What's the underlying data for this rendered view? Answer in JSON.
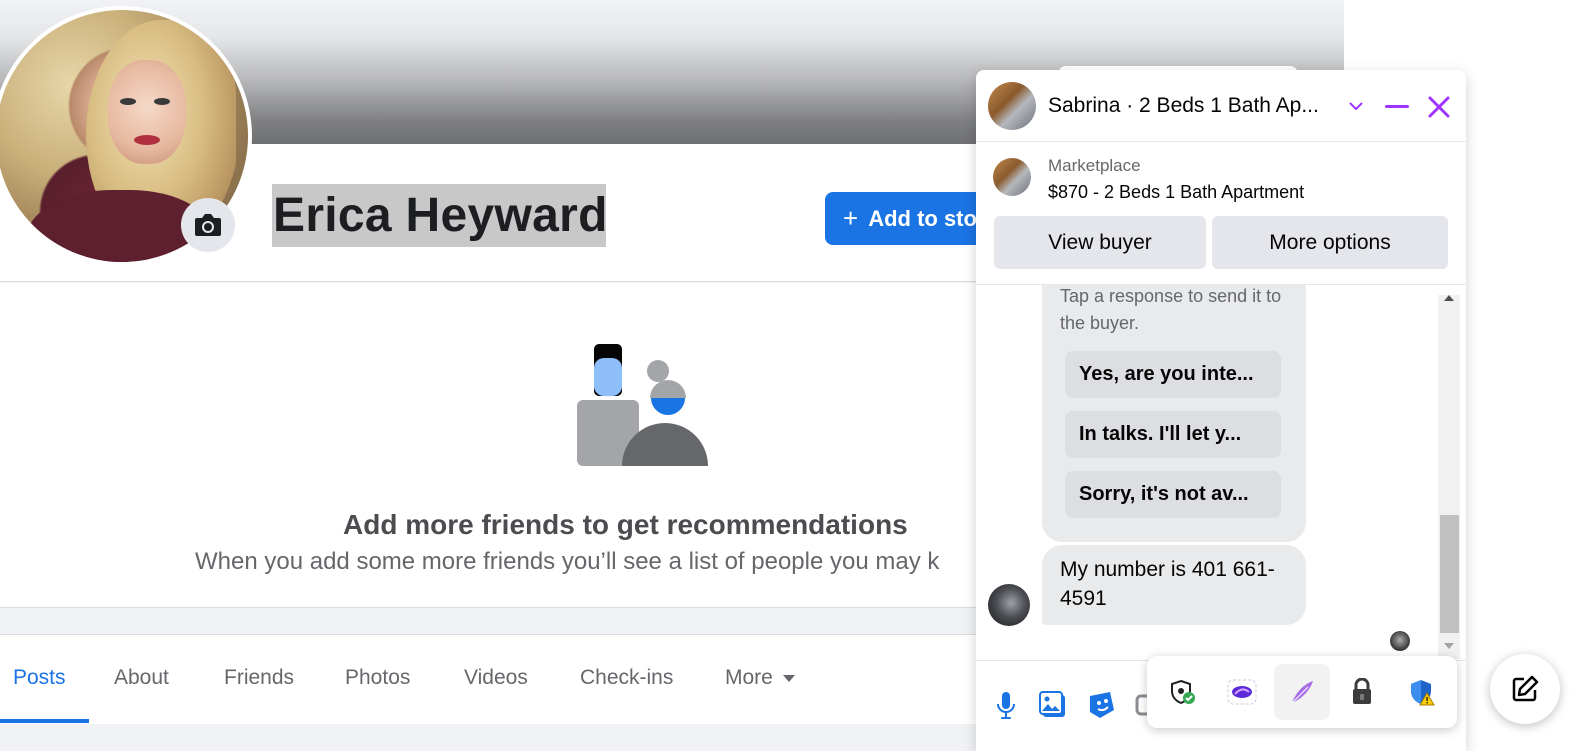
{
  "profile": {
    "name": "Erica Heyward",
    "add_story_label": "Add to sto"
  },
  "recommendations": {
    "title": "Add more friends to get recommendations",
    "subtitle": "When you add some more friends you’ll see a list of people you may k"
  },
  "tabs": [
    {
      "label": "Posts",
      "active": true
    },
    {
      "label": "About"
    },
    {
      "label": "Friends"
    },
    {
      "label": "Photos"
    },
    {
      "label": "Videos"
    },
    {
      "label": "Check-ins"
    },
    {
      "label": "More"
    }
  ],
  "chat": {
    "title": "Sabrina · 2 Beds 1 Bath Ap...",
    "marketplace_label": "Marketplace",
    "listing": "$870 - 2 Beds 1 Bath Apartment",
    "view_buyer": "View buyer",
    "more_options": "More options",
    "hint": "Tap a response to send it to the buyer.",
    "quick_replies": [
      "Yes, are you inte...",
      "In talks. I'll let y...",
      "Sorry, it's not av..."
    ],
    "message": "My number is 401 661-4591"
  },
  "colors": {
    "accent": "#1b74e4",
    "messenger_purple": "#a033ff",
    "page_bg": "#f0f2f5"
  },
  "icons": {
    "camera": "camera-icon",
    "minimize": "minimize-icon",
    "close": "close-icon",
    "compose": "compose-icon"
  }
}
